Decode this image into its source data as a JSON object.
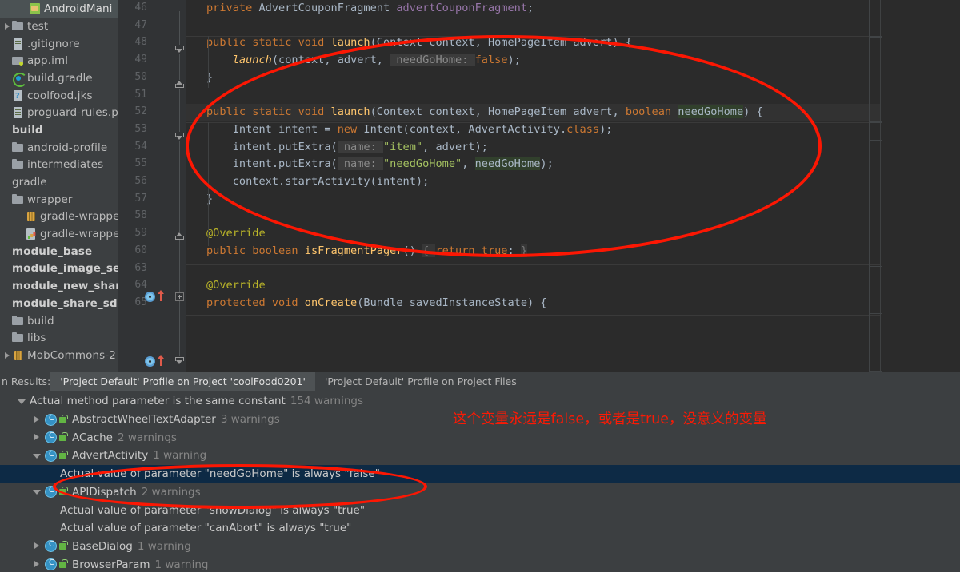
{
  "sidebar": {
    "active_file": "AndroidMani",
    "items": [
      {
        "label": "test",
        "icon": "folder-icon",
        "arrow": "right",
        "indent": 0,
        "bold": false
      },
      {
        "label": ".gitignore",
        "icon": "file-icon",
        "arrow": "none",
        "indent": 0,
        "bold": false
      },
      {
        "label": "app.iml",
        "icon": "folder-dot-icon",
        "arrow": "none",
        "indent": 0,
        "bold": false
      },
      {
        "label": "build.gradle",
        "icon": "gradle-icon",
        "arrow": "none",
        "indent": 0,
        "bold": false
      },
      {
        "label": "coolfood.jks",
        "icon": "key-icon",
        "arrow": "none",
        "indent": 0,
        "bold": false
      },
      {
        "label": "proguard-rules.pro",
        "icon": "file-icon",
        "arrow": "none",
        "indent": 0,
        "bold": false
      },
      {
        "label": "build",
        "icon": "none",
        "arrow": "none",
        "indent": 0,
        "bold": true
      },
      {
        "label": "android-profile",
        "icon": "folder-icon",
        "arrow": "none",
        "indent": 0,
        "bold": false
      },
      {
        "label": "intermediates",
        "icon": "folder-icon",
        "arrow": "none",
        "indent": 0,
        "bold": false
      },
      {
        "label": "gradle",
        "icon": "none",
        "arrow": "none",
        "indent": 0,
        "bold": false
      },
      {
        "label": "wrapper",
        "icon": "folder-icon",
        "arrow": "none",
        "indent": 0,
        "bold": false
      },
      {
        "label": "gradle-wrapper.j",
        "icon": "jar-icon",
        "arrow": "none",
        "indent": 1,
        "bold": false
      },
      {
        "label": "gradle-wrapper.p",
        "icon": "props-icon",
        "arrow": "none",
        "indent": 1,
        "bold": false
      },
      {
        "label": "module_base",
        "icon": "none",
        "arrow": "none",
        "indent": 0,
        "bold": true
      },
      {
        "label": "module_image_select",
        "icon": "none",
        "arrow": "none",
        "indent": 0,
        "bold": true
      },
      {
        "label": "module_new_share_sd",
        "icon": "none",
        "arrow": "none",
        "indent": 0,
        "bold": true
      },
      {
        "label": "module_share_sdk",
        "icon": "none",
        "arrow": "none",
        "indent": 0,
        "bold": true
      },
      {
        "label": "build",
        "icon": "folder-icon",
        "arrow": "none",
        "indent": 0,
        "bold": false
      },
      {
        "label": "libs",
        "icon": "folder-icon",
        "arrow": "none",
        "indent": 0,
        "bold": false
      },
      {
        "label": "MobCommons-2",
        "icon": "jar-icon",
        "arrow": "right",
        "indent": 0,
        "bold": false
      }
    ]
  },
  "editor": {
    "line_numbers": [
      "46",
      "47",
      "48",
      "49",
      "50",
      "51",
      "52",
      "53",
      "54",
      "55",
      "56",
      "57",
      "58",
      "59",
      "60",
      "63",
      "64",
      "65"
    ],
    "lines": [
      {
        "n": "46",
        "html": "<span class=\"kw\">private</span> AdvertCouponFragment <span class=\"fld\">advertCouponFragment</span>;"
      },
      {
        "n": "47",
        "html": ""
      },
      {
        "n": "48",
        "html": "<span class=\"kw\">public static void</span> <span class=\"fn\">launch</span>(Context context, HomePageItem advert) {"
      },
      {
        "n": "49",
        "html": "    <span class=\"fn\" style=\"font-style:italic\">launch</span>(context, advert, <span class=\"hintbg\"> needGoHome: </span><span class=\"kw\">false</span>);"
      },
      {
        "n": "50",
        "html": "}"
      },
      {
        "n": "51",
        "html": ""
      },
      {
        "n": "52",
        "html": "<span class=\"kw\">public static void</span> <span class=\"fn\">launch</span>(Context context, HomePageItem advert, <span class=\"kw\">boolean</span> <span class=\"caret\"></span><span class=\"greenhl\">needGoHome</span>) {"
      },
      {
        "n": "53",
        "html": "    Intent intent = <span class=\"kw\">new</span> Intent(context, AdvertActivity.<span class=\"kw\">class</span>);"
      },
      {
        "n": "54",
        "html": "    intent.putExtra(<span class=\"hintbg\"> name: </span><span class=\"str\">\"item\"</span>, advert);"
      },
      {
        "n": "55",
        "html": "    intent.putExtra(<span class=\"hintbg\"> name: </span><span class=\"str\">\"needGoHome\"</span>, <span class=\"greenhl\">needGoHome</span>);"
      },
      {
        "n": "56",
        "html": "    context.startActivity(intent);"
      },
      {
        "n": "57",
        "html": "}"
      },
      {
        "n": "58",
        "html": ""
      },
      {
        "n": "59",
        "html": "<span class=\"ann\">@Override</span>"
      },
      {
        "n": "60",
        "html": "<span class=\"kw\">public boolean</span> <span class=\"fn\">isFragmentPager</span>() <span class=\"foldhl\">{ </span><span class=\"kw\">return true</span>; <span class=\"foldhl\">}</span>"
      },
      {
        "n": "63",
        "html": ""
      },
      {
        "n": "64",
        "html": "<span class=\"ann\">@Override</span>"
      },
      {
        "n": "65",
        "html": "<span class=\"kw\">protected void</span> <span class=\"fn\">onCreate</span>(Bundle savedInstanceState) {"
      }
    ]
  },
  "results": {
    "title": "n Results:",
    "tabs": [
      {
        "label": "'Project Default' Profile on Project 'coolFood0201'",
        "active": true
      },
      {
        "label": "'Project Default' Profile on Project Files",
        "active": false
      }
    ],
    "tree": [
      {
        "indent": 0,
        "arrow": "down",
        "icon": "none",
        "text": "Actual method parameter is the same constant",
        "count": "154 warnings",
        "selected": false
      },
      {
        "indent": 1,
        "arrow": "right",
        "icon": "class",
        "text": "AbstractWheelTextAdapter",
        "count": "3 warnings",
        "selected": false
      },
      {
        "indent": 1,
        "arrow": "right",
        "icon": "class",
        "text": "ACache",
        "count": "2 warnings",
        "selected": false
      },
      {
        "indent": 1,
        "arrow": "down",
        "icon": "class",
        "text": "AdvertActivity",
        "count": "1 warning",
        "selected": false
      },
      {
        "indent": 2,
        "arrow": "none",
        "icon": "none",
        "text": "Actual value of parameter \"needGoHome\" is always \"false\"",
        "count": "",
        "selected": true
      },
      {
        "indent": 1,
        "arrow": "down",
        "icon": "class",
        "text": "APIDispatch",
        "count": "2 warnings",
        "selected": false
      },
      {
        "indent": 2,
        "arrow": "none",
        "icon": "none",
        "text": "Actual value of parameter \"showDialog\" is always \"true\"",
        "count": "",
        "selected": false
      },
      {
        "indent": 2,
        "arrow": "none",
        "icon": "none",
        "text": "Actual value of parameter \"canAbort\" is always \"true\"",
        "count": "",
        "selected": false
      },
      {
        "indent": 1,
        "arrow": "right",
        "icon": "class",
        "text": "BaseDialog",
        "count": "1 warning",
        "selected": false
      },
      {
        "indent": 1,
        "arrow": "right",
        "icon": "class",
        "text": "BrowserParam",
        "count": "1 warning",
        "selected": false
      }
    ]
  },
  "annotations": {
    "note_text": "这个变量永远是false，或者是true，没意义的变量",
    "note_color": "#fa1a05",
    "ellipse_color": "#fc1703"
  }
}
